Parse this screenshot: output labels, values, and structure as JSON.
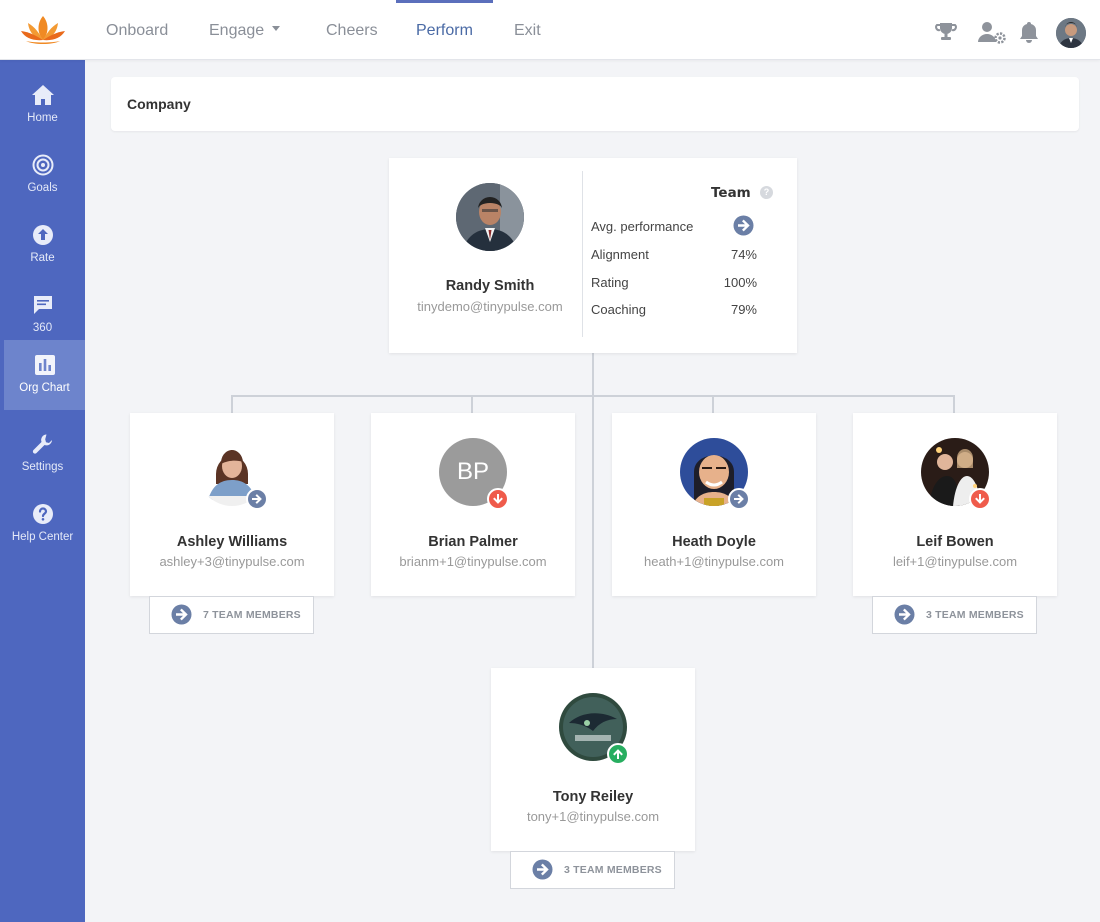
{
  "nav": {
    "items": [
      {
        "label": "Onboard"
      },
      {
        "label": "Engage"
      },
      {
        "label": "Cheers"
      },
      {
        "label": "Perform"
      },
      {
        "label": "Exit"
      }
    ],
    "active": "Perform",
    "icons": [
      "trophy-icon",
      "user-settings-icon",
      "bell-icon"
    ]
  },
  "sidebar": {
    "items": [
      {
        "label": "Home",
        "icon": "home-icon"
      },
      {
        "label": "Goals",
        "icon": "target-icon"
      },
      {
        "label": "Rate",
        "icon": "arrow-up-circle-icon"
      },
      {
        "label": "360",
        "icon": "chat-icon"
      },
      {
        "label": "Org Chart",
        "icon": "bar-chart-icon"
      },
      {
        "label": "Settings",
        "icon": "wrench-icon"
      },
      {
        "label": "Help Center",
        "icon": "help-circle-icon"
      }
    ],
    "active": "Org Chart"
  },
  "breadcrumb": {
    "label": "Company"
  },
  "manager": {
    "name": "Randy Smith",
    "email": "tinydemo@tinypulse.com",
    "team_header": "Team",
    "metrics": [
      {
        "label": "Avg. performance",
        "value": ""
      },
      {
        "label": "Alignment",
        "value": "74%"
      },
      {
        "label": "Rating",
        "value": "100%"
      },
      {
        "label": "Coaching",
        "value": "79%"
      }
    ]
  },
  "reports": [
    {
      "name": "Ashley Williams",
      "email": "ashley+3@tinypulse.com",
      "trend": "neutral",
      "team_button": "7 TEAM MEMBERS"
    },
    {
      "name": "Brian Palmer",
      "email": "brianm+1@tinypulse.com",
      "initials": "BP",
      "trend": "down"
    },
    {
      "name": "Heath Doyle",
      "email": "heath+1@tinypulse.com",
      "trend": "neutral"
    },
    {
      "name": "Leif Bowen",
      "email": "leif+1@tinypulse.com",
      "trend": "down",
      "team_button": "3 TEAM MEMBERS"
    },
    {
      "name": "Tony Reiley",
      "email": "tony+1@tinypulse.com",
      "trend": "up",
      "team_button": "3 TEAM MEMBERS"
    }
  ],
  "colors": {
    "sidebar": "#4e67bf",
    "sidebar_active": "#6d84cc",
    "accent": "#5b6fbc",
    "trend_neutral": "#6b7fa6",
    "trend_down": "#ef5b4b",
    "trend_up": "#27ae60"
  }
}
